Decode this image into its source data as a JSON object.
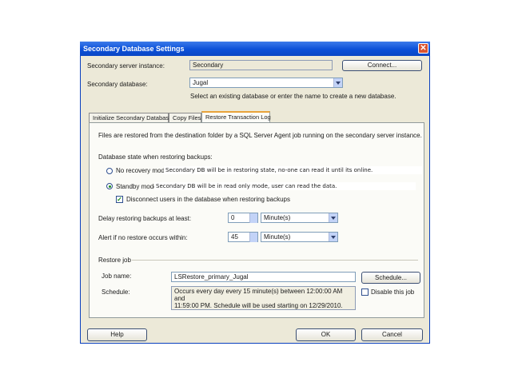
{
  "window": {
    "title": "Secondary Database Settings",
    "close_glyph": "✕"
  },
  "secondary_server": {
    "label": "Secondary server instance:",
    "value": "Secondary",
    "connect_label": "Connect..."
  },
  "secondary_database": {
    "label": "Secondary database:",
    "value": "Jugal",
    "hint": "Select an existing database or enter the name to create a new database."
  },
  "tabs": [
    {
      "label": "Initialize Secondary Database"
    },
    {
      "label": "Copy Files"
    },
    {
      "label": "Restore Transaction Log"
    }
  ],
  "restore_tab": {
    "intro": "Files are restored from the destination folder by a SQL Server Agent job running on the secondary server instance.",
    "state_label": "Database state when restoring backups:",
    "no_recovery": {
      "label": "No recovery mode",
      "note": "Secondary DB will be in restoring state, no-one can read it until its online.",
      "selected": false
    },
    "standby": {
      "label": "Standby mode",
      "note": "Secondary DB will be in read only mode, user can read the data.",
      "selected": true
    },
    "disconnect": {
      "label": "Disconnect users in the database when restoring backups",
      "checked": true,
      "glyph": "✓"
    },
    "delay": {
      "label": "Delay restoring backups at least:",
      "value": "0",
      "unit": "Minute(s)"
    },
    "alert": {
      "label": "Alert if no restore occurs within:",
      "value": "45",
      "unit": "Minute(s)"
    },
    "restore_job": {
      "section_label": "Restore job",
      "job_name_label": "Job name:",
      "job_name_value": "LSRestore_primary_Jugal",
      "schedule_button": "Schedule...",
      "schedule_label": "Schedule:",
      "schedule_line1": "Occurs every day every 15 minute(s) between 12:00:00 AM and",
      "schedule_line2": "11:59:00 PM. Schedule will be used starting on 12/29/2010.",
      "disable_label": "Disable this job",
      "disable_checked": false
    }
  },
  "footer": {
    "help": "Help",
    "ok": "OK",
    "cancel": "Cancel"
  }
}
